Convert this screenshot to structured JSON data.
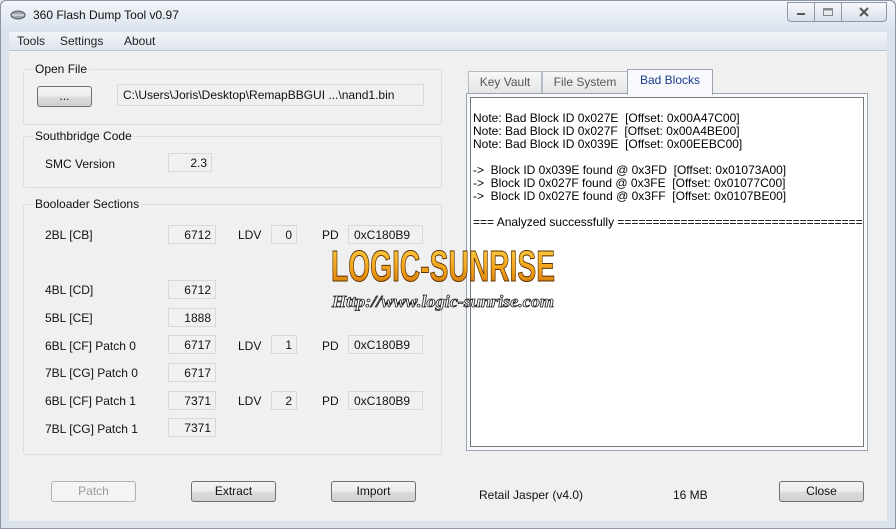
{
  "window": {
    "title": "360 Flash Dump Tool  v0.97"
  },
  "menu": [
    "Tools",
    "Settings",
    "About"
  ],
  "open_file": {
    "label": "Open File",
    "browse_label": "...",
    "path": "C:\\Users\\Joris\\Desktop\\RemapBBGUI ...\\nand1.bin"
  },
  "southbridge": {
    "label": "Southbridge Code",
    "smc_label": "SMC Version",
    "smc_value": "2.3"
  },
  "bootloader": {
    "label": "Booloader Sections",
    "rows": [
      {
        "name": "2BL [CB]",
        "value": "6712",
        "ldv_label": "LDV",
        "ldv": "0",
        "pd_label": "PD",
        "pd": "0xC180B9"
      },
      {
        "name": "4BL [CD]",
        "value": "6712"
      },
      {
        "name": "5BL [CE]",
        "value": "1888"
      },
      {
        "name": "6BL [CF] Patch 0",
        "value": "6717",
        "ldv_label": "LDV",
        "ldv": "1",
        "pd_label": "PD",
        "pd": "0xC180B9"
      },
      {
        "name": "7BL [CG] Patch 0",
        "value": "6717"
      },
      {
        "name": "6BL [CF] Patch 1",
        "value": "7371",
        "ldv_label": "LDV",
        "ldv": "2",
        "pd_label": "PD",
        "pd": "0xC180B9"
      },
      {
        "name": "7BL [CG] Patch 1",
        "value": "7371"
      }
    ]
  },
  "tabs": [
    "Key Vault",
    "File System",
    "Bad Blocks"
  ],
  "active_tab": "Bad Blocks",
  "log_lines": [
    "Note: Bad Block ID 0x027E  [Offset: 0x00A47C00]",
    "Note: Bad Block ID 0x027F  [Offset: 0x00A4BE00]",
    "Note: Bad Block ID 0x039E  [Offset: 0x00EEBC00]",
    "",
    "->  Block ID 0x039E found @ 0x3FD  [Offset: 0x01073A00]",
    "->  Block ID 0x027F found @ 0x3FE  [Offset: 0x01077C00]",
    "->  Block ID 0x027E found @ 0x3FF  [Offset: 0x0107BE00]",
    "",
    "=== Analyzed successfully =========================================="
  ],
  "buttons": {
    "patch": "Patch",
    "extract": "Extract",
    "import": "Import",
    "close": "Close"
  },
  "status": {
    "console": "Retail Jasper (v4.0)",
    "size": "16 MB"
  },
  "watermark": {
    "title": "LOGIC-SUNRISE",
    "url": "Http://www.logic-sunrise.com"
  },
  "colors": {
    "active_tab_text": "#1a3b8f",
    "watermark_orange": "#f2a21b"
  }
}
